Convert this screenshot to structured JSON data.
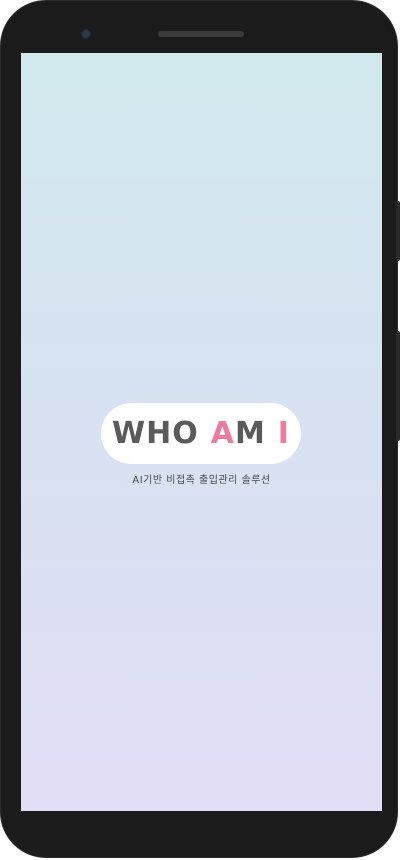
{
  "splash": {
    "logo": {
      "who": "WHO",
      "a": "A",
      "m": "M",
      "i": "I"
    },
    "tagline": "AI기반 비접촉 출입관리 솔루션"
  },
  "colors": {
    "accent": "#f07a9e",
    "logo_text": "#5a5a5a",
    "gradient_top": "#d2eaee",
    "gradient_bottom": "#e2def6"
  }
}
